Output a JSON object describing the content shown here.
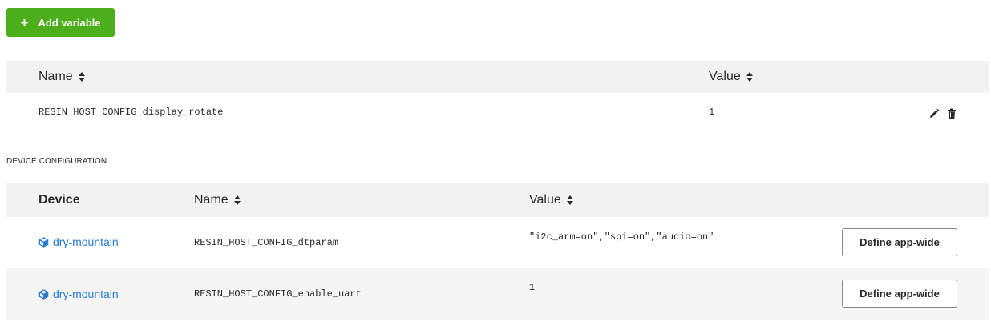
{
  "toolbar": {
    "add_variable_label": "Add variable"
  },
  "app_variables": {
    "columns": {
      "name": "Name",
      "value": "Value"
    },
    "rows": [
      {
        "name": "RESIN_HOST_CONFIG_display_rotate",
        "value": "1"
      }
    ]
  },
  "device_configuration": {
    "section_label": "DEVICE CONFIGURATION",
    "columns": {
      "device": "Device",
      "name": "Name",
      "value": "Value"
    },
    "rows": [
      {
        "device": "dry-mountain",
        "name": "RESIN_HOST_CONFIG_dtparam",
        "value": "\"i2c_arm=on\",\"spi=on\",\"audio=on\"",
        "action_label": "Define app-wide"
      },
      {
        "device": "dry-mountain",
        "name": "RESIN_HOST_CONFIG_enable_uart",
        "value": "1",
        "action_label": "Define app-wide"
      }
    ]
  },
  "icons": {
    "add": "plus-icon",
    "sort": "sort-icon",
    "edit": "pencil-icon",
    "delete": "trash-icon",
    "device": "cube-icon"
  },
  "colors": {
    "primary": "#4cae1a",
    "link": "#2a7bd0",
    "header_bg": "#f2f2f2"
  }
}
